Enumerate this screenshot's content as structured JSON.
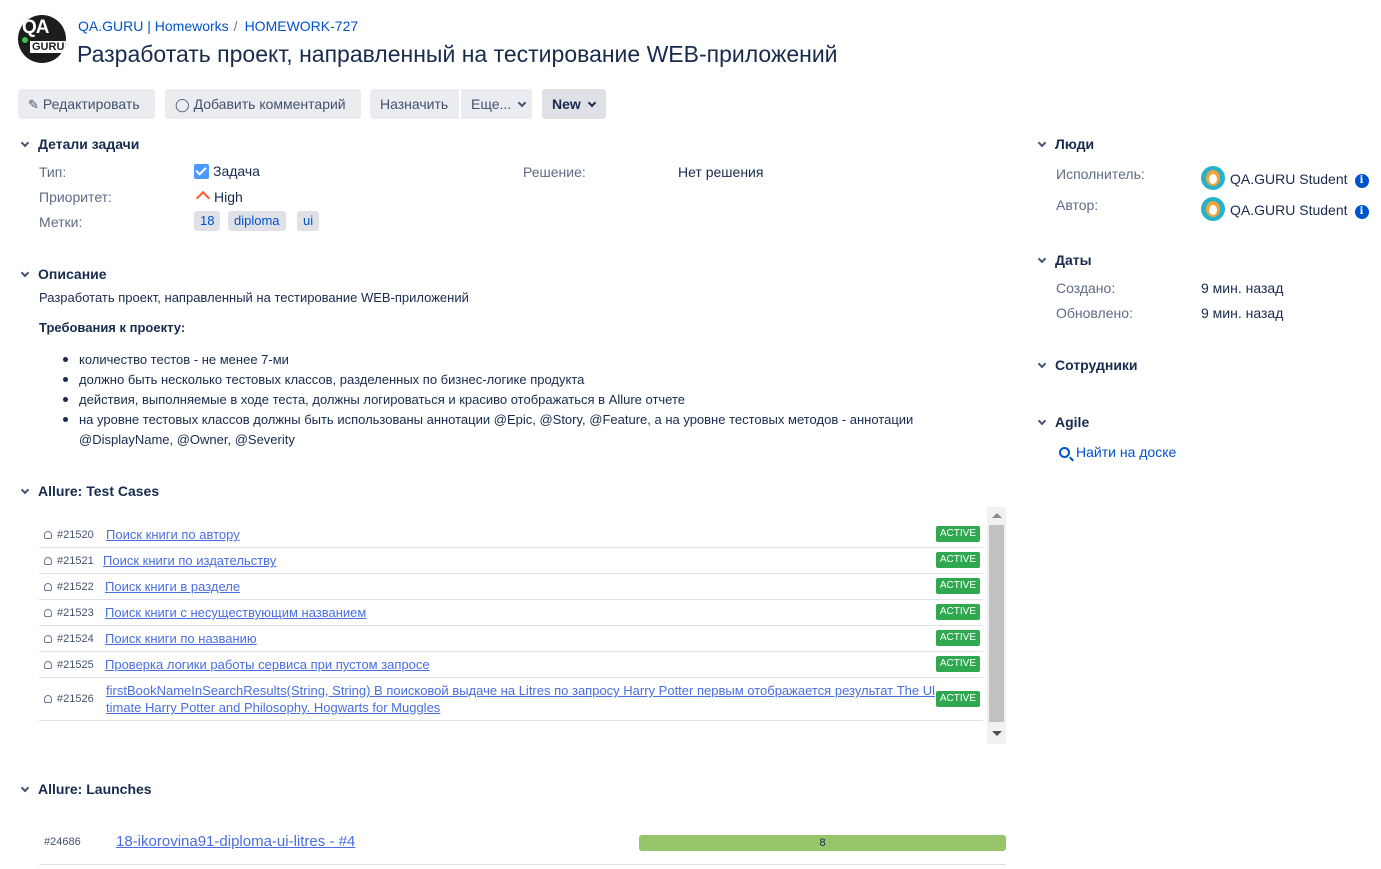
{
  "breadcrumbs": [
    "QA.GURU | Homeworks",
    "HOMEWORK-727"
  ],
  "title": "Разработать проект, направленный на тестирование WEB-приложений",
  "logo": {
    "top": "QA",
    "bottom": "GURU"
  },
  "toolbar": {
    "edit": "Редактировать",
    "comment": "Добавить комментарий",
    "assign": "Назначить",
    "more": "Еще...",
    "status": "New"
  },
  "details": {
    "header": "Детали задачи",
    "type_label": "Тип:",
    "type_value": "Задача",
    "priority_label": "Приоритет:",
    "priority_value": "High",
    "labels_label": "Метки:",
    "labels": [
      "18",
      "diploma",
      "ui"
    ],
    "resolution_label": "Решение:",
    "resolution_value": "Нет решения"
  },
  "description": {
    "header": "Описание",
    "text": "Разработать проект, направленный на тестирование WEB-приложений",
    "subheader": "Требования к проекту:",
    "items": [
      "количество тестов - не менее 7-ми",
      "должно быть несколько тестовых классов, разделенных по бизнес-логике продукта",
      "действия, выполняемые в ходе теста, должны логироваться и красиво отображаться в Allure отчете",
      "на уровне тестовых классов должны быть использованы аннотации @Epic, @Story, @Feature, а на уровне тестовых методов - аннотации @DisplayName, @Owner, @Severity"
    ]
  },
  "test_cases": {
    "header": "Allure: Test Cases",
    "rows": [
      {
        "id": "#21520",
        "name": "Поиск книги по автору",
        "status": "ACTIVE"
      },
      {
        "id": "#21521",
        "name": "Поиск книги по издательству",
        "status": "ACTIVE"
      },
      {
        "id": "#21522",
        "name": "Поиск книги в разделе",
        "status": "ACTIVE"
      },
      {
        "id": "#21523",
        "name": "Поиск книги с несуществующим названием",
        "status": "ACTIVE"
      },
      {
        "id": "#21524",
        "name": "Поиск книги по названию",
        "status": "ACTIVE"
      },
      {
        "id": "#21525",
        "name": "Проверка логики работы сервиса при пустом запросе",
        "status": "ACTIVE"
      },
      {
        "id": "#21526",
        "name": "firstBookNameInSearchResults(String, String) В поисковой выдаче на Litres по запросу Harry Potter первым отображается результат The Ultimate Harry Potter and Philosophy. Hogwarts for Muggles",
        "status": "ACTIVE"
      }
    ]
  },
  "launches": {
    "header": "Allure: Launches",
    "rows": [
      {
        "id": "#24686",
        "name": "18-ikorovina91-diploma-ui-litres - #4",
        "passed": 8,
        "progress": 1.0
      }
    ]
  },
  "people": {
    "header": "Люди",
    "assignee_label": "Исполнитель:",
    "assignee": "QA.GURU Student",
    "reporter_label": "Автор:",
    "reporter": "QA.GURU Student"
  },
  "dates": {
    "header": "Даты",
    "created_label": "Создано:",
    "created": "9 мин. назад",
    "updated_label": "Обновлено:",
    "updated": "9 мин. назад"
  },
  "staff": {
    "header": "Сотрудники"
  },
  "agile": {
    "header": "Agile",
    "link": "Найти на доске"
  },
  "colors": {
    "link": "#0052cc",
    "badge": "#2fa84f",
    "progress": "#97c56a"
  }
}
